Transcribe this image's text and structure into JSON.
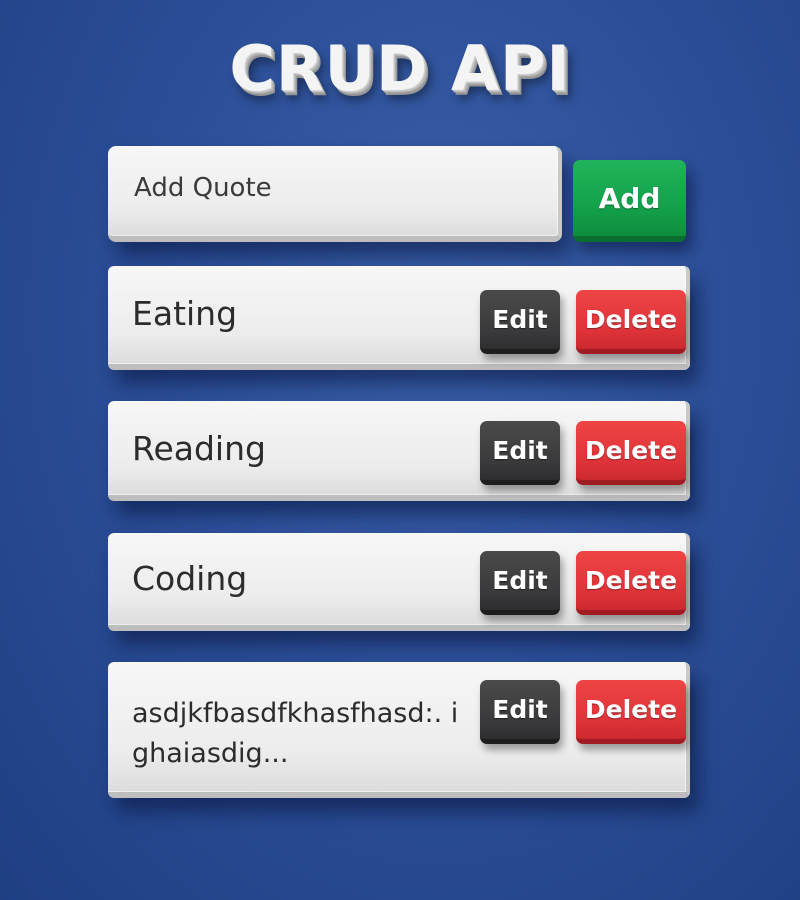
{
  "header": {
    "title": "CRUD API"
  },
  "form": {
    "input_placeholder": "Add Quote",
    "input_value": "",
    "add_label": "Add"
  },
  "quotes": [
    {
      "text": "Eating",
      "edit_label": "Edit",
      "delete_label": "Delete"
    },
    {
      "text": "Reading",
      "edit_label": "Edit",
      "delete_label": "Delete"
    },
    {
      "text": "Coding",
      "edit_label": "Edit",
      "delete_label": "Delete"
    },
    {
      "text": "asdjkfbasdfkhasfhasd:. ighaiasdig...",
      "edit_label": "Edit",
      "delete_label": "Delete"
    }
  ],
  "colors": {
    "background": "#2c4f98",
    "add_button": "#14a24b",
    "edit_button": "#3a3a3c",
    "delete_button": "#e0343a",
    "card": "#ececec"
  }
}
